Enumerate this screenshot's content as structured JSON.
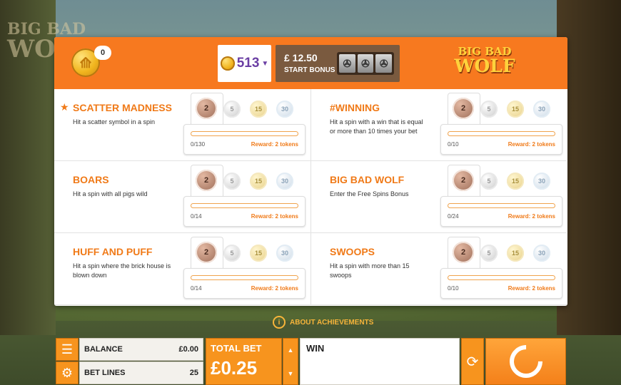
{
  "header": {
    "token_count": "0",
    "coin_balance": "513",
    "bonus_price": "£ 12.50",
    "bonus_label": "START BONUS",
    "logo_line1": "BIG BAD",
    "logo_line2": "WOLF"
  },
  "background": {
    "logo_line1": "BIG BAD",
    "logo_line2": "WOL"
  },
  "achievements": [
    {
      "title": "SCATTER MADNESS",
      "starred": true,
      "desc": "Hit a scatter symbol in a spin",
      "progress": "0/130",
      "fraction": 0,
      "reward": "Reward: 2 tokens",
      "tiers": [
        "2",
        "5",
        "15",
        "30"
      ]
    },
    {
      "title": "#WINNING",
      "starred": false,
      "desc": "Hit a spin with a win that is equal or more than 10 times your bet",
      "progress": "0/10",
      "fraction": 0,
      "reward": "Reward: 2 tokens",
      "tiers": [
        "2",
        "5",
        "15",
        "30"
      ]
    },
    {
      "title": "BOARS",
      "starred": false,
      "desc": "Hit a spin with all pigs wild",
      "progress": "0/14",
      "fraction": 0,
      "reward": "Reward: 2 tokens",
      "tiers": [
        "2",
        "5",
        "15",
        "30"
      ]
    },
    {
      "title": "BIG BAD WOLF",
      "starred": false,
      "desc": "Enter the Free Spins Bonus",
      "progress": "0/24",
      "fraction": 0,
      "reward": "Reward: 2 tokens",
      "tiers": [
        "2",
        "5",
        "15",
        "30"
      ]
    },
    {
      "title": "HUFF AND PUFF",
      "starred": false,
      "desc": "Hit a spin where the brick house is blown down",
      "progress": "0/14",
      "fraction": 0,
      "reward": "Reward: 2 tokens",
      "tiers": [
        "2",
        "5",
        "15",
        "30"
      ]
    },
    {
      "title": "SWOOPS",
      "starred": false,
      "desc": "Hit a spin with more than 15 swoops",
      "progress": "0/10",
      "fraction": 0,
      "reward": "Reward: 2 tokens",
      "tiers": [
        "2",
        "5",
        "15",
        "30"
      ]
    }
  ],
  "about_label": "ABOUT ACHIEVEMENTS",
  "bottom": {
    "balance_label": "BALANCE",
    "balance_value": "£0.00",
    "betlines_label": "BET LINES",
    "betlines_value": "25",
    "total_bet_label": "TOTAL BET",
    "total_bet_value": "£0.25",
    "win_label": "WIN"
  },
  "colors": {
    "accent": "#f7791f",
    "title": "#f07a18",
    "coin_balance": "#6b3fa4"
  }
}
